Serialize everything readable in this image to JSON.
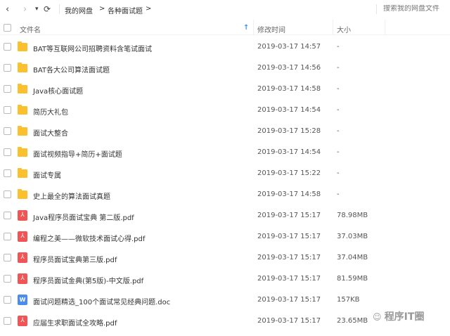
{
  "toolbar": {
    "back": "‹",
    "forward": "›",
    "dropdown": "▾",
    "refresh": "⟳",
    "breadcrumb": [
      "我的网盘",
      "各种面试题"
    ],
    "separator": ">",
    "search_placeholder": "搜索我的网盘文件"
  },
  "header": {
    "name": "文件名",
    "sort_arrow": "↑",
    "modified": "修改时间",
    "size": "大小"
  },
  "files": [
    {
      "type": "folder",
      "name": "BAT等互联网公司招聘资料含笔试面试",
      "time": "2019-03-17 14:57",
      "size": "-"
    },
    {
      "type": "folder",
      "name": "BAT各大公司算法面试题",
      "time": "2019-03-17 14:56",
      "size": "-"
    },
    {
      "type": "folder",
      "name": "Java核心面试题",
      "time": "2019-03-17 14:58",
      "size": "-"
    },
    {
      "type": "folder",
      "name": "简历大礼包",
      "time": "2019-03-17 14:54",
      "size": "-"
    },
    {
      "type": "folder",
      "name": "面试大整合",
      "time": "2019-03-17 15:28",
      "size": "-"
    },
    {
      "type": "folder",
      "name": "面试视频指导+简历+面试题",
      "time": "2019-03-17 14:54",
      "size": "-"
    },
    {
      "type": "folder",
      "name": "面试专属",
      "time": "2019-03-17 15:22",
      "size": "-"
    },
    {
      "type": "folder",
      "name": "史上最全的算法面试真题",
      "time": "2019-03-17 14:58",
      "size": "-"
    },
    {
      "type": "pdf",
      "name": "Java程序员面试宝典 第二版.pdf",
      "time": "2019-03-17 15:17",
      "size": "78.98MB"
    },
    {
      "type": "pdf",
      "name": "编程之美——微软技术面试心得.pdf",
      "time": "2019-03-17 15:17",
      "size": "37.03MB"
    },
    {
      "type": "pdf",
      "name": "程序员面试宝典第三版.pdf",
      "time": "2019-03-17 15:17",
      "size": "37.04MB"
    },
    {
      "type": "pdf",
      "name": "程序员面试金典(第5版)-中文版.pdf",
      "time": "2019-03-17 15:17",
      "size": "81.59MB"
    },
    {
      "type": "doc",
      "name": "面试问题精选_100个面试常见经典问题.doc",
      "time": "2019-03-17 15:17",
      "size": "157KB"
    },
    {
      "type": "pdf",
      "name": "应届生求职面试全攻略.pdf",
      "time": "2019-03-17 15:17",
      "size": "23.65MB"
    }
  ],
  "icons": {
    "pdf": "⅄",
    "doc": "W"
  },
  "watermark": "程序IT圈"
}
